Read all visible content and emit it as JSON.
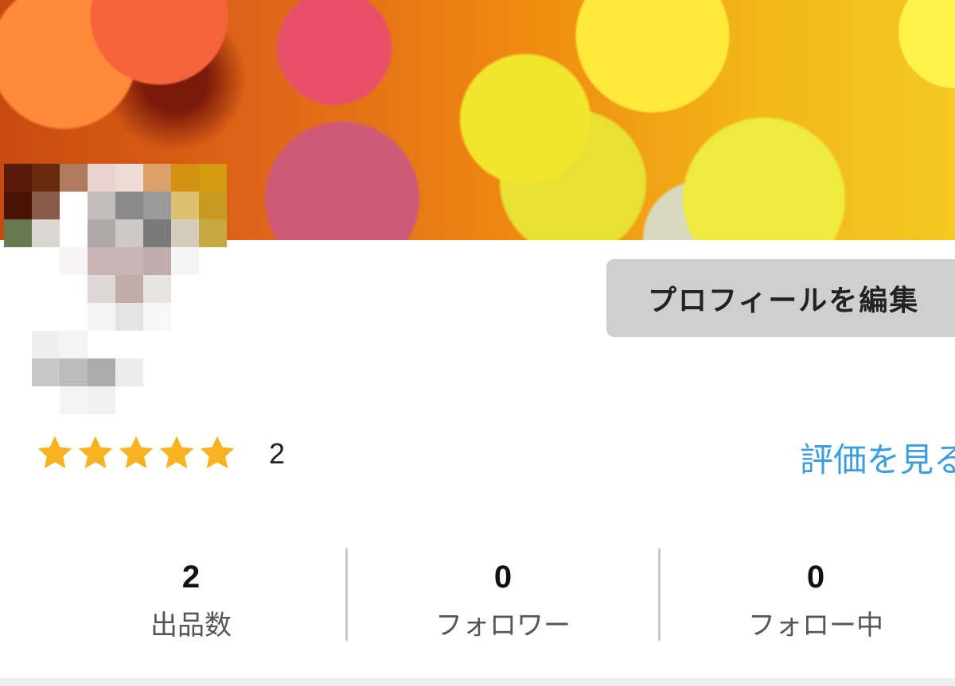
{
  "profile": {
    "edit_button_label": "プロフィールを編集",
    "rating": {
      "stars": 5,
      "count": "2",
      "view_reviews_label": "評価を見る"
    },
    "stats": [
      {
        "value": "2",
        "label": "出品数"
      },
      {
        "value": "0",
        "label": "フォロワー"
      },
      {
        "value": "0",
        "label": "フォロー中"
      }
    ]
  },
  "colors": {
    "star": "#f9b320",
    "link": "#3c9ee0",
    "button_bg": "#cfcfcf"
  },
  "icons": {
    "star": "star-icon"
  }
}
